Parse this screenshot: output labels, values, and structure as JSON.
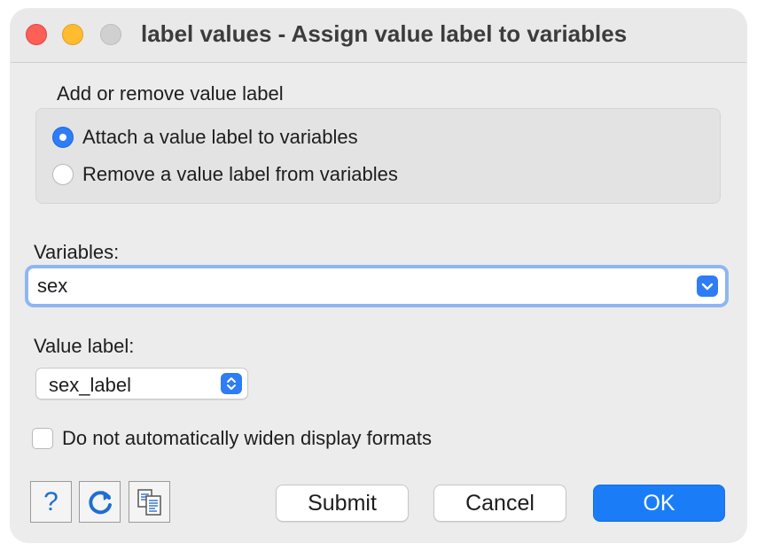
{
  "window": {
    "title": "label values - Assign value label to variables"
  },
  "group": {
    "label": "Add or remove value label",
    "options": [
      {
        "label": "Attach a value label to variables",
        "selected": true
      },
      {
        "label": "Remove a value label from variables",
        "selected": false
      }
    ]
  },
  "variables": {
    "label": "Variables:",
    "value": "sex"
  },
  "value_label": {
    "label": "Value label:",
    "selected": "sex_label"
  },
  "options": {
    "no_widen_label": "Do not automatically widen display formats",
    "no_widen_checked": false
  },
  "toolbar": {
    "help_glyph": "?",
    "help_icon": "question-mark-icon",
    "reset_icon": "refresh-icon",
    "copy_icon": "copy-command-icon"
  },
  "buttons": {
    "submit": "Submit",
    "cancel": "Cancel",
    "ok": "OK"
  },
  "colors": {
    "accent": "#1a7df7",
    "close": "#fe5f57",
    "minimize": "#febc2e",
    "zoom_disabled": "#d0d0d0"
  }
}
